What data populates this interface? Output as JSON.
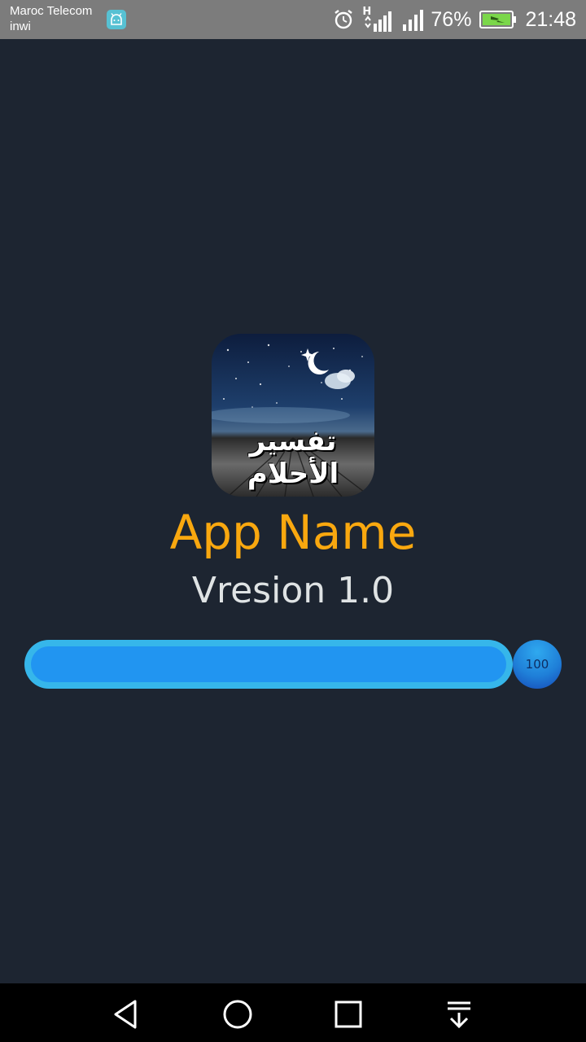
{
  "status_bar": {
    "carrier_line1": "Maroc Telecom",
    "carrier_line2": "inwi",
    "network_type": "H",
    "battery_percent": "76%",
    "time": "21:48"
  },
  "splash": {
    "icon_caption": "تفسير الأحلام",
    "app_name": "App Name",
    "version": "Vresion 1.0",
    "progress_value": "100",
    "progress_fraction": 1.0
  },
  "colors": {
    "background": "#1d2531",
    "app_name": "#f9a80f",
    "progress_track": "#36b6ea",
    "progress_fill": "#2195f1"
  },
  "nav_bar": {
    "icons": [
      "back-icon",
      "home-icon",
      "recents-icon",
      "notification-pull-icon"
    ]
  }
}
